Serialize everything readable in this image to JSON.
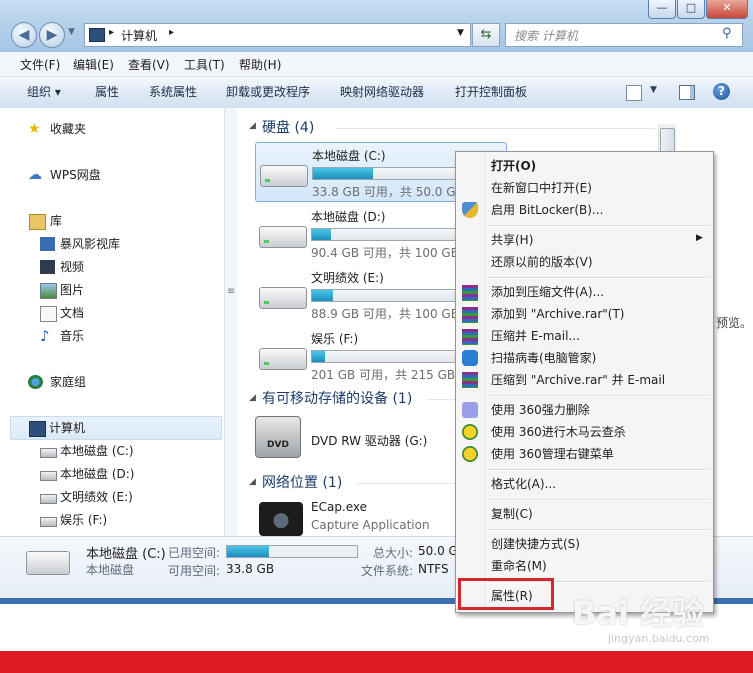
{
  "address": {
    "path": "计算机"
  },
  "search": {
    "placeholder": "搜索 计算机"
  },
  "window_buttons": [
    "—",
    "□",
    "✕"
  ],
  "menu": [
    "文件(F)",
    "编辑(E)",
    "查看(V)",
    "工具(T)",
    "帮助(H)"
  ],
  "commands": [
    "组织 ▾",
    "属性",
    "系统属性",
    "卸载或更改程序",
    "映射网络驱动器",
    "打开控制面板"
  ],
  "nav": {
    "favorites": "收藏夹",
    "wps": "WPS网盘",
    "library": "库",
    "library_items": [
      "暴风影视库",
      "视频",
      "图片",
      "文档",
      "音乐"
    ],
    "homegroup": "家庭组",
    "computer": "计算机",
    "computer_items": [
      "本地磁盘 (C:)",
      "本地磁盘 (D:)",
      "文明绩效 (E:)",
      "娱乐 (F:)"
    ]
  },
  "groups": {
    "hdd": "硬盘 (4)",
    "removable": "有可移动存储的设备 (1)",
    "network": "网络位置 (1)"
  },
  "drives": [
    {
      "name": "本地磁盘 (C:)",
      "info": "33.8 GB 可用，共 50.0 GB",
      "used_fraction": 0.32
    },
    {
      "name": "本地磁盘 (D:)",
      "info": "90.4 GB 可用，共 100 GB",
      "used_fraction": 0.1
    },
    {
      "name": "文明绩效 (E:)",
      "info": "88.9 GB 可用，共 100 GB",
      "used_fraction": 0.11
    },
    {
      "name": "娱乐 (F:)",
      "info": "201 GB 可用，共 215 GB",
      "used_fraction": 0.07
    }
  ],
  "dvd": {
    "name": "DVD RW 驱动器 (G:)",
    "icon_text": "DVD"
  },
  "network_item": {
    "name": "ECap.exe",
    "desc": "Capture Application"
  },
  "right_overflow_text": "预览。",
  "details": {
    "name": "本地磁盘 (C:)",
    "type": "本地磁盘",
    "used_label": "已用空间:",
    "free_label": "可用空间:",
    "free_value": "33.8 GB",
    "total_label": "总大小:",
    "total_value": "50.0 G",
    "fs_label": "文件系统:",
    "fs_value": "NTFS",
    "used_fraction": 0.32
  },
  "context_menu": {
    "open": "打开(O)",
    "open_new": "在新窗口中打开(E)",
    "bitlocker": "启用 BitLocker(B)...",
    "share": "共享(H)",
    "restore": "还原以前的版本(V)",
    "add_archive": "添加到压缩文件(A)...",
    "add_rar": "添加到 \"Archive.rar\"(T)",
    "compress_email": "压缩并 E-mail...",
    "scan": "扫描病毒(电脑管家)",
    "compress_rar_email": "压缩到 \"Archive.rar\" 并 E-mail",
    "force_delete": "使用 360强力删除",
    "trojan_scan": "使用 360进行木马云查杀",
    "manage_menu": "使用 360管理右键菜单",
    "format": "格式化(A)...",
    "copy": "复制(C)",
    "shortcut": "创建快捷方式(S)",
    "rename": "重命名(M)",
    "properties": "属性(R)"
  },
  "watermark": {
    "logo": "Bai 经验",
    "url": "jingyan.baidu.com"
  },
  "colors": {
    "accent": "#1f8fbe",
    "highlight_box": "#d6262d",
    "bottom_bar": "#e01a23"
  }
}
